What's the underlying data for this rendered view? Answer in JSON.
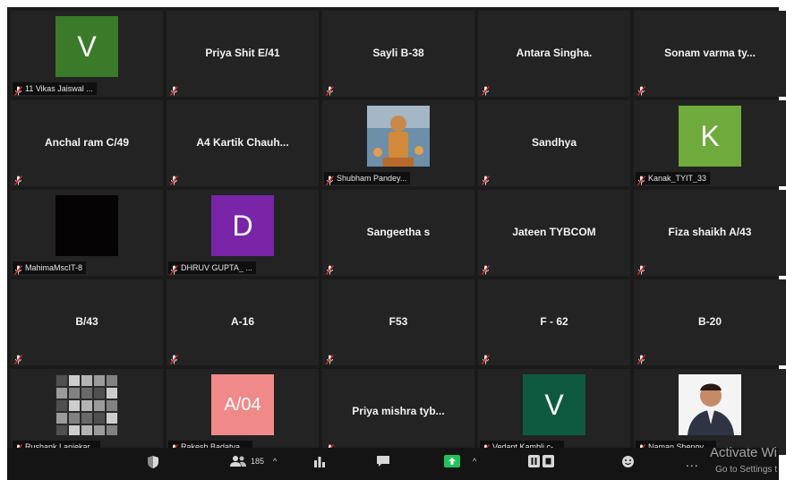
{
  "participants_count": "185",
  "watermark": {
    "title": "Activate Wi",
    "subtitle": "Go to Settings t"
  },
  "tiles": [
    {
      "name": "",
      "footer": "11 Vikas Jaiswal ...",
      "avatar": "V",
      "avatar_color": "#3a7a28"
    },
    {
      "name": "Priya Shit E/41",
      "footer": ""
    },
    {
      "name": "Sayli B-38",
      "footer": ""
    },
    {
      "name": "Antara Singha.",
      "footer": ""
    },
    {
      "name": "Sonam varma ty...",
      "footer": ""
    },
    {
      "name": "Anchal ram C/49",
      "footer": ""
    },
    {
      "name": "A4 Kartik Chauh...",
      "footer": ""
    },
    {
      "name": "",
      "footer": "Shubham Pandey...",
      "photo": "photo-shubham"
    },
    {
      "name": "Sandhya",
      "footer": ""
    },
    {
      "name": "",
      "footer": "Kanak_TYIT_33",
      "avatar": "K",
      "avatar_color": "#6eaa3c"
    },
    {
      "name": "",
      "footer": "MahimaMscIT-8",
      "photo": "photo-mahima"
    },
    {
      "name": "",
      "footer": "DHRUV GUPTA_ ...",
      "avatar": "D",
      "avatar_color": "#7a25a8"
    },
    {
      "name": "Sangeetha s",
      "footer": ""
    },
    {
      "name": "Jateen TYBCOM",
      "footer": ""
    },
    {
      "name": "Fiza shaikh A/43",
      "footer": ""
    },
    {
      "name": "B/43",
      "footer": ""
    },
    {
      "name": "A-16",
      "footer": ""
    },
    {
      "name": "F53",
      "footer": ""
    },
    {
      "name": "F - 62",
      "footer": ""
    },
    {
      "name": "B-20",
      "footer": ""
    },
    {
      "name": "",
      "footer": "Rushank Lanjekar...",
      "photo": "photo-rushank"
    },
    {
      "name": "",
      "footer": "Rakesh Badatya ...",
      "avatar": "A/04",
      "avatar_color": "#f08a8a"
    },
    {
      "name": "Priya mishra tyb...",
      "footer": ""
    },
    {
      "name": "",
      "footer": "Vedant Kambli c-...",
      "avatar": "V",
      "avatar_color": "#0e5a40"
    },
    {
      "name": "",
      "footer": "Naman Shenoy ...",
      "photo": "photo-naman"
    }
  ]
}
